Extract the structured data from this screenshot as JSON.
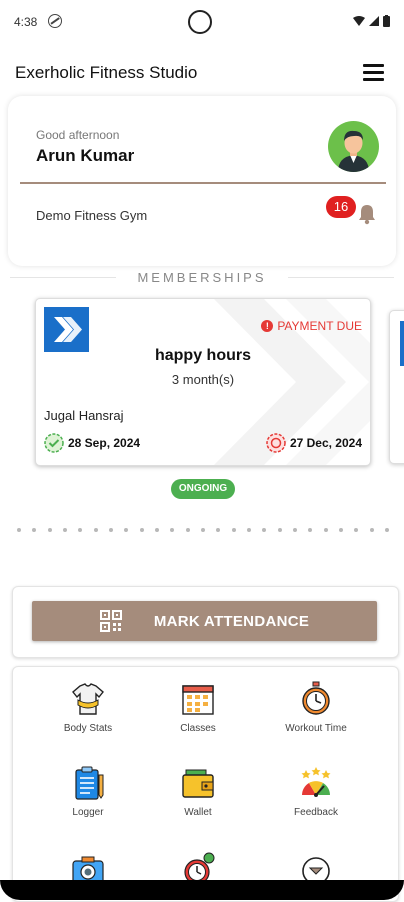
{
  "status_bar": {
    "time": "4:38"
  },
  "app_bar": {
    "title": "Exerholic Fitness Studio",
    "menu_icon": "hamburger-menu-icon"
  },
  "profile": {
    "greeting": "Good afternoon",
    "name": "Arun Kumar",
    "gym": "Demo Fitness Gym",
    "notification_count": "16"
  },
  "memberships": {
    "section_title": "MEMBERSHIPS",
    "card": {
      "status": "PAYMENT DUE",
      "plan_name": "happy hours",
      "duration": "3 month(s)",
      "trainer": "Jugal Hansraj",
      "start_date": "28 Sep, 2024",
      "end_date": "27 Dec, 2024"
    },
    "badge": "ONGOING"
  },
  "attendance": {
    "label": "MARK ATTENDANCE",
    "icon": "qr-code-icon"
  },
  "menu_grid": [
    {
      "label": "Body Stats",
      "icon": "tshirt-measure-icon"
    },
    {
      "label": "Classes",
      "icon": "calendar-classes-icon"
    },
    {
      "label": "Workout Time",
      "icon": "stopwatch-icon"
    },
    {
      "label": "Logger",
      "icon": "clipboard-icon"
    },
    {
      "label": "Wallet",
      "icon": "wallet-icon"
    },
    {
      "label": "Feedback",
      "icon": "rating-gauge-icon"
    },
    {
      "label": "",
      "icon": "camera-icon"
    },
    {
      "label": "",
      "icon": "alarm-clock-icon"
    },
    {
      "label": "",
      "icon": "expand-more-icon"
    }
  ],
  "colors": {
    "accent": "#a58c7c",
    "ongoing": "#4caf50",
    "due": "#e53935",
    "brand_blue": "#1a6fc9"
  }
}
